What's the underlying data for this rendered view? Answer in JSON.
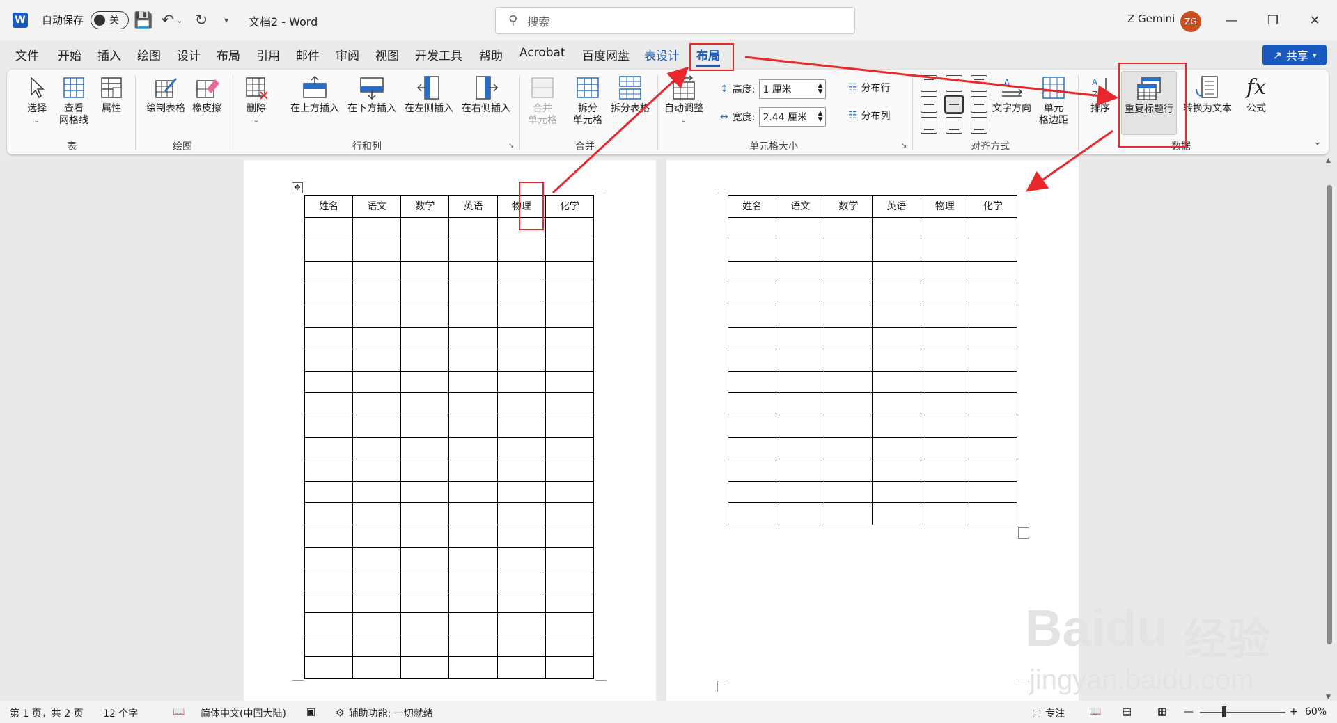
{
  "titlebar": {
    "autosave_label": "自动保存",
    "autosave_state": "关",
    "doc_title": "文档2  -  Word",
    "search_placeholder": "搜索",
    "user_name": "Z Gemini",
    "user_initials": "ZG"
  },
  "tabs": [
    "文件",
    "开始",
    "插入",
    "绘图",
    "设计",
    "布局",
    "引用",
    "邮件",
    "审阅",
    "视图",
    "开发工具",
    "帮助",
    "Acrobat",
    "百度网盘",
    "表设计",
    "布局"
  ],
  "active_tab": "布局",
  "share_label": "共享",
  "ribbon": {
    "table_group": {
      "label": "表",
      "select": "选择",
      "view_gridlines": "查看\n网格线",
      "properties": "属性"
    },
    "draw_group": {
      "label": "绘图",
      "draw_table": "绘制表格",
      "eraser": "橡皮擦"
    },
    "rows_cols_group": {
      "label": "行和列",
      "delete": "删除",
      "insert_above": "在上方插入",
      "insert_below": "在下方插入",
      "insert_left": "在左侧插入",
      "insert_right": "在右侧插入"
    },
    "merge_group": {
      "label": "合并",
      "merge_cells": "合并\n单元格",
      "split_cells": "拆分\n单元格",
      "split_table": "拆分表格"
    },
    "cell_size_group": {
      "label": "单元格大小",
      "autofit": "自动调整",
      "height_label": "高度:",
      "height_value": "1 厘米",
      "width_label": "宽度:",
      "width_value": "2.44 厘米",
      "distribute_rows": "分布行",
      "distribute_cols": "分布列"
    },
    "alignment_group": {
      "label": "对齐方式",
      "text_direction": "文字方向",
      "cell_margins": "单元\n格边距"
    },
    "data_group": {
      "label": "数据",
      "sort": "排序",
      "repeat_header_rows": "重复标题行",
      "convert_to_text": "转换为文本",
      "formula": "公式"
    }
  },
  "table_headers": [
    "姓名",
    "语文",
    "数学",
    "英语",
    "物理",
    "化学"
  ],
  "status": {
    "page": "第 1 页，共 2 页",
    "words": "12 个字",
    "language": "简体中文(中国大陆)",
    "accessibility": "辅助功能: 一切就绪",
    "focus": "专注",
    "zoom": "60%"
  },
  "watermark": {
    "brand": "Baidu",
    "brand_cn": "经验",
    "url": "jingyan.baidu.com"
  },
  "colors": {
    "accent": "#185abd",
    "annotation": "#e8282a",
    "avatar": "#c94f20"
  }
}
